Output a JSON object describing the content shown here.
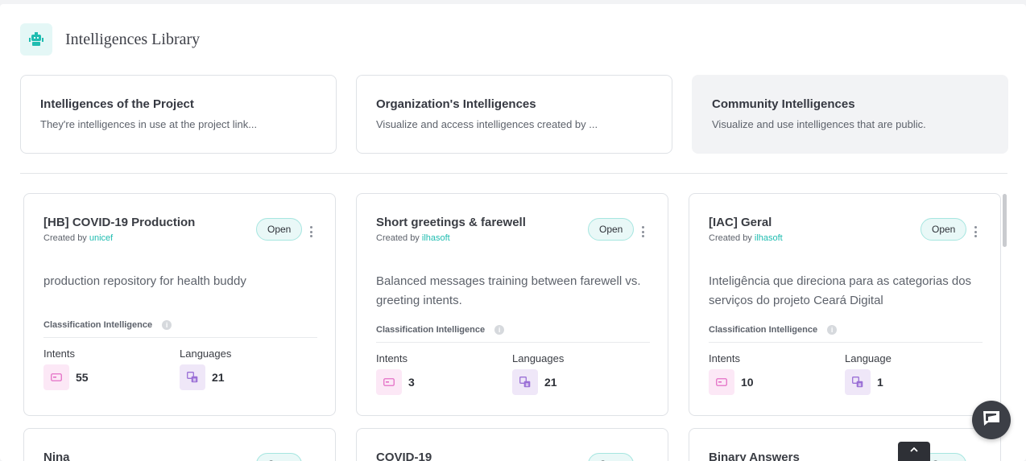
{
  "header": {
    "title": "Intelligences Library",
    "icon": "robot-icon"
  },
  "tabs": [
    {
      "title": "Intelligences of the Project",
      "description": "They're intelligences in use at the project link..."
    },
    {
      "title": "Organization's Intelligences",
      "description": "Visualize and access intelligences created by ..."
    },
    {
      "title": "Community Intelligences",
      "description": "Visualize and use intelligences that are public."
    }
  ],
  "cards": [
    {
      "title": "[HB] COVID-19 Production",
      "created_by_label": "Created by",
      "owner": "unicef",
      "status": "Open",
      "description": "production repository for health buddy",
      "type": "Classification Intelligence",
      "intents_label": "Intents",
      "intents": "55",
      "languages_label": "Languages",
      "languages": "21"
    },
    {
      "title": "Short greetings & farewell",
      "created_by_label": "Created by",
      "owner": "ilhasoft",
      "status": "Open",
      "description": "Balanced messages training between farewell vs. greeting intents.",
      "type": "Classification Intelligence",
      "intents_label": "Intents",
      "intents": "3",
      "languages_label": "Languages",
      "languages": "21"
    },
    {
      "title": "[IAC] Geral",
      "created_by_label": "Created by",
      "owner": "ilhasoft",
      "status": "Open",
      "description": "Inteligência que direciona para as categorias dos serviços do projeto Ceará Digital",
      "type": "Classification Intelligence",
      "intents_label": "Intents",
      "intents": "10",
      "languages_label": "Language",
      "languages": "1"
    },
    {
      "title": "Nina",
      "status": "Open"
    },
    {
      "title": "COVID-19",
      "status": "Open"
    },
    {
      "title": "Binary Answers",
      "status": "Open"
    }
  ],
  "colors": {
    "accent": "#1fbcb0",
    "badge_bg": "#e9f8f7",
    "intents_icon": "#e46fc6",
    "languages_icon": "#9a6fd6"
  }
}
